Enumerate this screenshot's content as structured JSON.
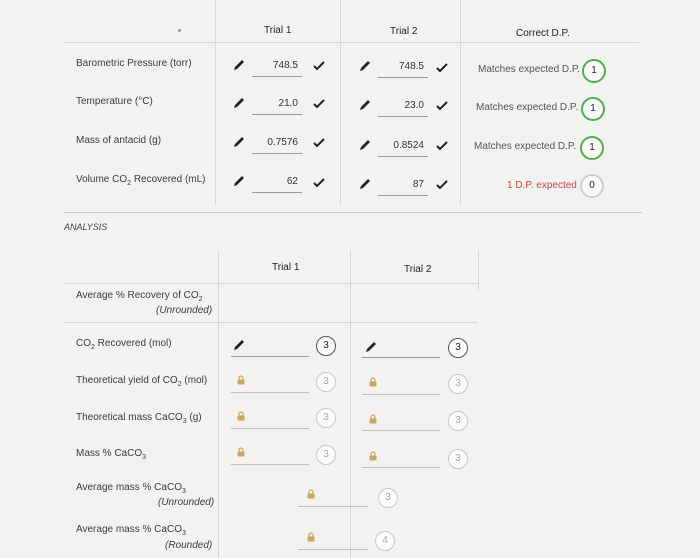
{
  "results": {
    "header": {
      "trial1": "Trial 1",
      "trial2": "Trial 2",
      "correct": "Correct D.P."
    },
    "rows": [
      {
        "label_html": "Barometric Pressure (torr)",
        "t1": "748.5",
        "t2": "748.5",
        "feedback": "Matches expected D.P.",
        "score": "1"
      },
      {
        "label_html": "Temperature (°C)",
        "t1": "21.0",
        "t2": "23.0",
        "feedback": "Matches expected D.P.",
        "score": "1"
      },
      {
        "label_html": "Mass of antacid (g)",
        "t1": "0.7576",
        "t2": "0.8524",
        "feedback": "Matches expected D.P.",
        "score": "1"
      },
      {
        "label_pre": "Volume CO",
        "label_sub": "2",
        "label_post": " Recovered (mL)",
        "t1": "62",
        "t2": "87",
        "feedback": "1 D.P. expected",
        "score": "0"
      }
    ]
  },
  "analysis": {
    "title": "ANALYSIS",
    "header": {
      "trial1": "Trial 1",
      "trial2": "Trial 2"
    },
    "avg_recovery": {
      "pre": "Average % Recovery of CO",
      "sub": "2",
      "note": "(Unrounded)"
    },
    "rows": [
      {
        "pre": "CO",
        "sub": "2",
        "post": " Recovered (mol)",
        "score1": "3",
        "score2": "3"
      },
      {
        "pre": "Theoretical yield of CO",
        "sub": "2",
        "post": " (mol)",
        "score1": "3",
        "score2": "3"
      },
      {
        "pre": "Theoretical mass CaCO",
        "sub": "3",
        "post": " (g)",
        "score1": "3",
        "score2": "3"
      },
      {
        "pre": "Mass % CaCO",
        "sub": "3",
        "post": "",
        "score1": "3",
        "score2": "3"
      }
    ],
    "avg_mass_unrounded": {
      "pre": "Average mass % CaCO",
      "sub": "3",
      "note": "(Unrounded)",
      "score": "3"
    },
    "avg_mass_rounded": {
      "pre": "Average mass % CaCO",
      "sub": "3",
      "note": "(Rounded)",
      "score": "4"
    }
  },
  "colors": {
    "green_ring": "#4caf50",
    "warn_text": "#c24e3e"
  }
}
